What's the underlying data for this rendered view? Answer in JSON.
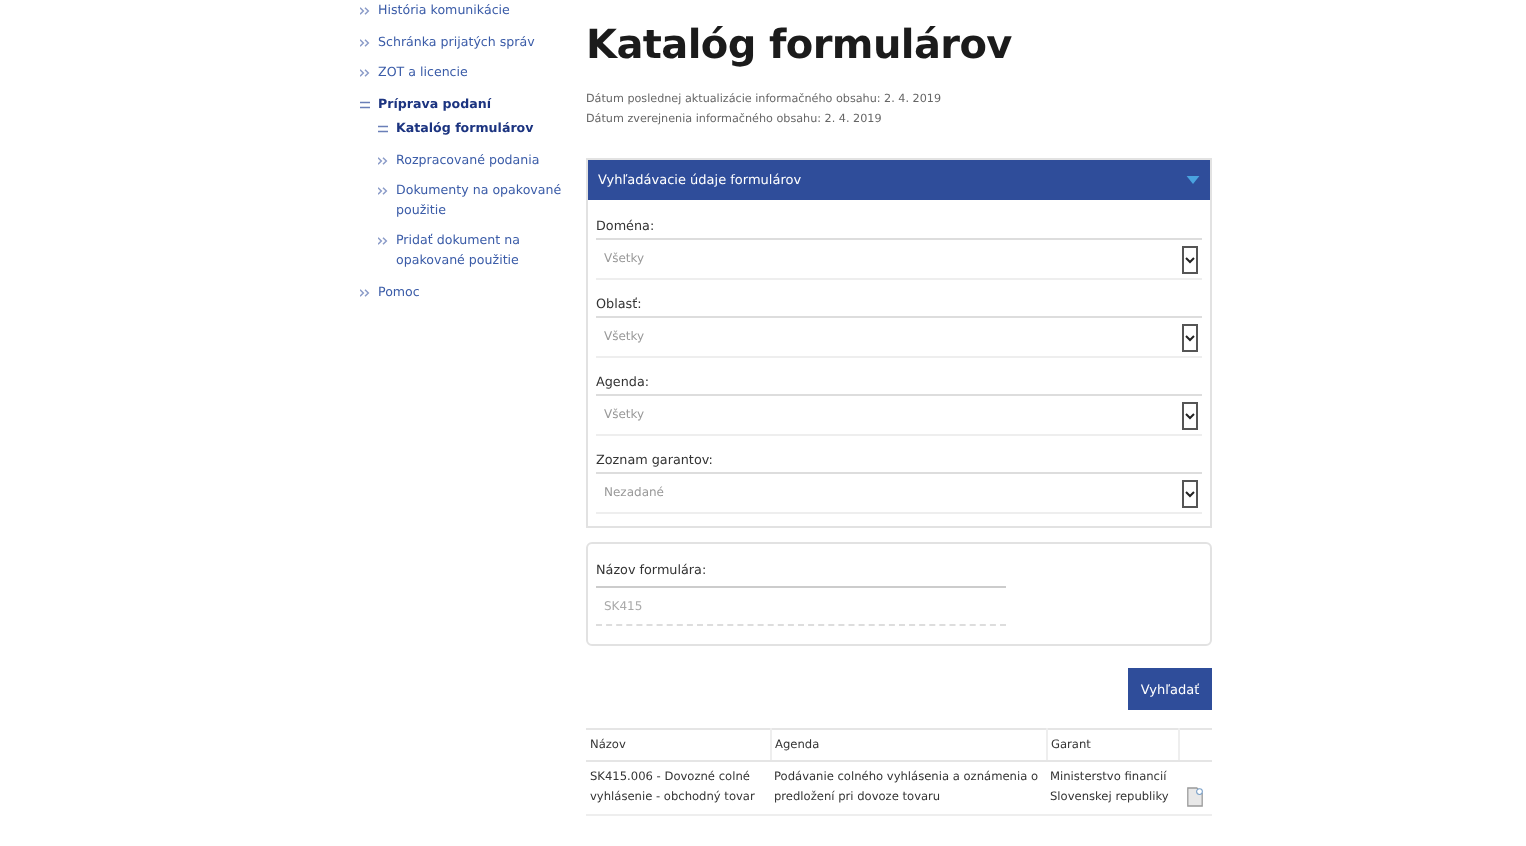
{
  "sidebar": {
    "items": [
      {
        "label": "História komunikácie",
        "expanded": false
      },
      {
        "label": "Schránka prijatých správ",
        "expanded": false
      },
      {
        "label": "ZOT a licencie",
        "expanded": false
      },
      {
        "label": "Príprava podaní",
        "expanded": true,
        "children": [
          {
            "label": "Katalóg formulárov",
            "selected": true
          },
          {
            "label": "Rozpracované podania",
            "selected": false
          },
          {
            "label": "Dokumenty na opakované použitie",
            "selected": false
          },
          {
            "label": "Pridať dokument na opakované použitie",
            "selected": false
          }
        ]
      },
      {
        "label": "Pomoc",
        "expanded": false
      }
    ]
  },
  "page": {
    "title": "Katalóg formulárov",
    "dates": [
      "Dátum poslednej aktualizácie informačného obsahu: 2. 4. 2019",
      "Dátum zverejnenia informačného obsahu: 2. 4. 2019"
    ]
  },
  "search_panel": {
    "title": "Vyhľadávacie údaje formulárov",
    "expanded": true,
    "fields": [
      {
        "label": "Doména:",
        "value": "Všetky"
      },
      {
        "label": "Oblasť:",
        "value": "Všetky"
      },
      {
        "label": "Agenda:",
        "value": "Všetky"
      },
      {
        "label": "Zoznam garantov:",
        "value": "Nezadané"
      }
    ]
  },
  "name_field": {
    "label": "Názov formulára:",
    "placeholder": "SK415"
  },
  "search_button": "Vyhľadať",
  "table": {
    "columns": [
      "Názov",
      "Agenda",
      "Garant"
    ],
    "rows": [
      {
        "cells": [
          "SK415.006 - Dovozné colné vyhlásenie - obchodný tovar",
          "Podávanie colného vyhlásenia a oznámenia o predložení pri dovoze tovaru",
          "Ministerstvo financií Slovenskej republiky"
        ]
      }
    ]
  }
}
